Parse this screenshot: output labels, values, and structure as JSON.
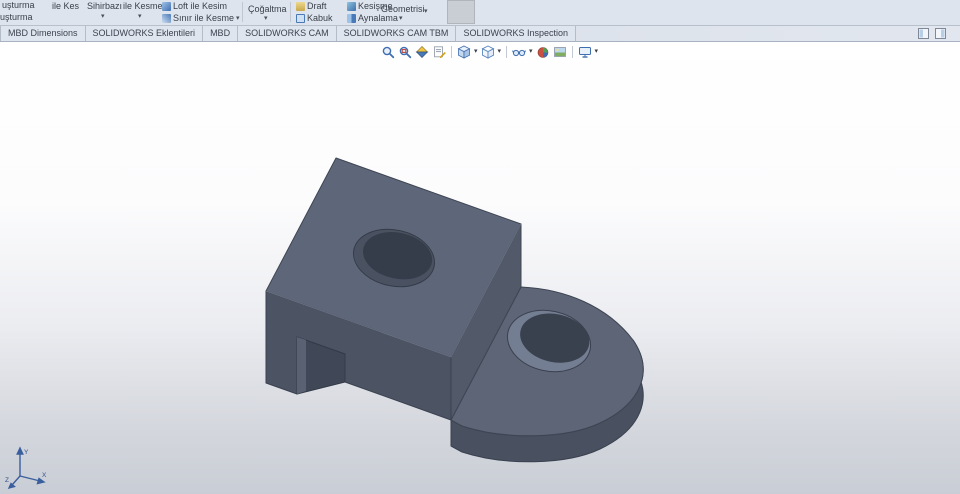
{
  "app": {
    "name": "SOLIDWORKS",
    "language": "Turkish"
  },
  "ribbon": {
    "caret": "▾",
    "partial_left": {
      "line1": "uşturma",
      "line2": "uşturma"
    },
    "simple_items": [
      {
        "label": "ile Kes",
        "caret": false
      },
      {
        "label": "Sihirbazı",
        "caret": true
      },
      {
        "label": "ile Kesme",
        "caret": true
      }
    ],
    "cut_group": {
      "row1": {
        "label": "Loft ile Kesim",
        "icon": "loft-cut"
      },
      "row2": {
        "label": "Sınır ile Kesme",
        "icon": "boundary-cut"
      }
    },
    "pattern_item": {
      "label": "Çoğaltma",
      "caret": true
    },
    "feature_grid": [
      {
        "label": "Draft",
        "icon": "draft"
      },
      {
        "label": "Kesişme",
        "icon": "intersect"
      },
      {
        "label": "Kabuk",
        "icon": "shell"
      },
      {
        "label": "Aynalama",
        "icon": "mirror"
      }
    ],
    "geometry_item": {
      "label": "Geometrisi",
      "caret": true
    },
    "icons": [
      "loft-cut",
      "boundary-cut",
      "draft",
      "shell",
      "intersect",
      "mirror"
    ]
  },
  "tab_bar": {
    "tabs": [
      "MBD Dimensions",
      "SOLIDWORKS Eklentileri",
      "MBD",
      "SOLIDWORKS CAM",
      "SOLIDWORKS CAM TBM",
      "SOLIDWORKS Inspection"
    ],
    "right_icons": [
      "pane-icon-left",
      "pane-icon-right"
    ]
  },
  "view_toolbar": {
    "caret": "▾",
    "icons": [
      "zoom-to-fit",
      "zoom-to-area",
      "section-view",
      "dynamic-annotation-views",
      "view-orientation",
      "display-style",
      "hide-show-items",
      "edit-appearance",
      "apply-scene",
      "view-settings"
    ],
    "carets_after": [
      "view-orientation",
      "display-style",
      "hide-show-items",
      "view-settings"
    ]
  },
  "viewport": {
    "triad": {
      "x": "X",
      "y": "Y",
      "z": "Z"
    },
    "colors": {
      "part_top": "#5e6779",
      "part_front": "#4c5463",
      "part_right": "#525a6a",
      "part_side_band": "#4a5261",
      "hole_dark": "#363d4a",
      "background_top": "#ffffff",
      "background_bottom": "#c9cdd5",
      "triad_blue": "#3a5f9e"
    }
  }
}
